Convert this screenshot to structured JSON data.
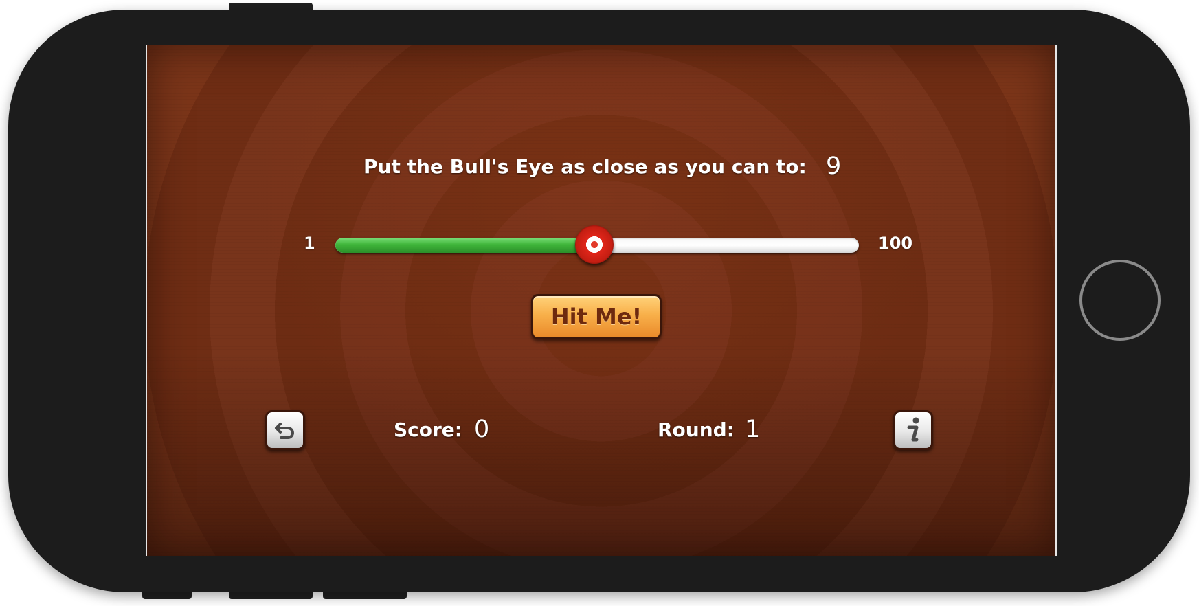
{
  "game": {
    "prompt_label": "Put the Bull's Eye as close as you can to:",
    "target_value": "9",
    "slider": {
      "min_label": "1",
      "max_label": "100",
      "value": 50,
      "min": 1,
      "max": 100,
      "fill_color": "#3fb53a",
      "thumb_color": "#e0261a"
    },
    "hit_button_label": "Hit Me!",
    "score_label": "Score:",
    "score_value": "0",
    "round_label": "Round:",
    "round_value": "1",
    "restart_icon": "restart-arrow-icon",
    "info_icon": "info-icon"
  },
  "colors": {
    "background_wood": "#6f2c13",
    "button_orange": "#f8b04a",
    "button_text": "#6e2a0e",
    "device_body": "#1c1c1c"
  }
}
